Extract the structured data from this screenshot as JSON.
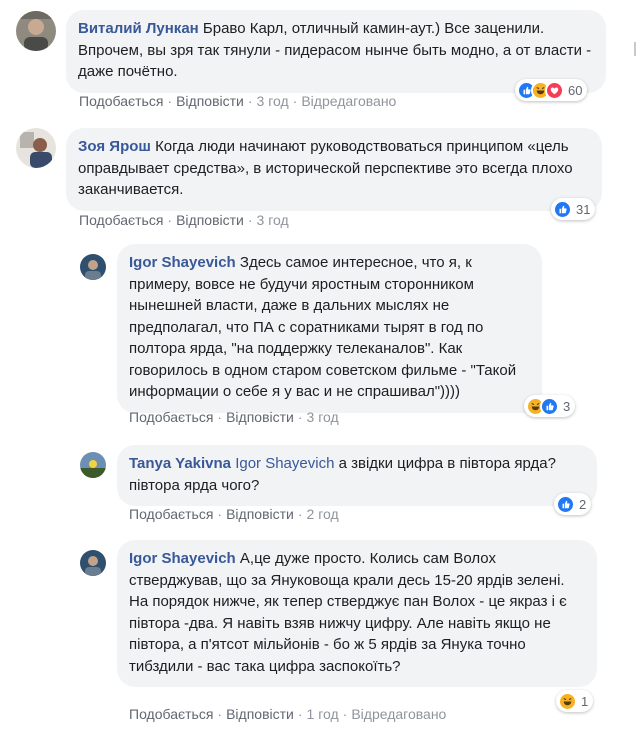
{
  "colors": {
    "author": "#385898",
    "bubble": "#f2f3f5",
    "like_blue": "#2078f4",
    "love_red": "#f33e58",
    "haha_yellow": "#f7b125"
  },
  "comments": [
    {
      "author": "Виталий Лункан",
      "text": "Браво Карл, отличный камин-аут.) Все заценили. Впрочем, вы зря так тянули - пидерасом нынче быть модно, а от власти - даже почётно.",
      "actions": {
        "like": "Подобається",
        "reply": "Відповісти",
        "time": "3 год",
        "edited": "Відредаговано"
      },
      "reactions": {
        "icons": [
          "like-icon",
          "haha-icon",
          "love-icon"
        ],
        "count": "60"
      }
    },
    {
      "author": "Зоя Ярош",
      "text": "Когда люди начинают руководствоваться принципом «цель оправдывает средства», в исторической перспективе это всегда плохо заканчивается.",
      "actions": {
        "like": "Подобається",
        "reply": "Відповісти",
        "time": "3 год"
      },
      "reactions": {
        "icons": [
          "like-icon"
        ],
        "count": "31"
      }
    },
    {
      "author": "Igor Shayevich",
      "text": "Здесь самое интересное, что я, к примеру, вовсе не будучи ярostным сторонником нынешней власти, даже в дальних мыслях не предполагал, что ПА с соратниками тырят в год по полтора ярда, \"на поддержку телеканалов\". Как говорилось в одном старом советском фильме - \"Такой информации о себе я у вас и не спрашивал\"))))",
      "actions": {
        "like": "Подобається",
        "reply": "Відповісти",
        "time": "3 год"
      },
      "reactions": {
        "icons": [
          "haha-icon",
          "like-icon"
        ],
        "count": "3"
      }
    },
    {
      "author": "Tanya Yakivna",
      "mention": "Igor Shayevich",
      "text": "а звідки цифра в півтора ярда? півтора ярда чого?",
      "actions": {
        "like": "Подобається",
        "reply": "Відповісти",
        "time": "2 год"
      },
      "reactions": {
        "icons": [
          "like-icon"
        ],
        "count": "2"
      }
    },
    {
      "author": "Igor Shayevich",
      "text": "А,це дуже просто. Колись сам Волох стверджував, що за Януковоща крали десь 15-20 ярдів зелені. На порядок нижче, як тепер стверджує пан Волох - це якраз і є півтора -два. Я навіть взяв нижчу цифру. Але навіть якщо не півтора, а п'ятсот мільйонів - бо ж 5 ярдів за Янука точно тибздили - вас така цифра заспокоїть?",
      "actions": {
        "like": "Подобається",
        "reply": "Відповісти",
        "time": "1 год",
        "edited": "Відредаговано"
      },
      "reactions": {
        "icons": [
          "haha-icon"
        ],
        "count": "1"
      }
    }
  ]
}
